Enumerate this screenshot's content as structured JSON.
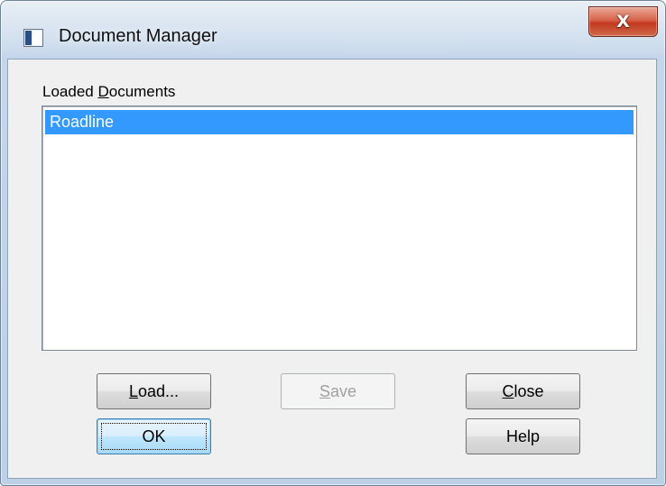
{
  "window": {
    "title": "Document Manager",
    "close_glyph": "X",
    "icon": "app-document-icon"
  },
  "list": {
    "label_prefix": "Loaded ",
    "label_mnemonic": "D",
    "label_rest": "ocuments",
    "items": [
      {
        "label": "Roadline",
        "selected": true
      }
    ]
  },
  "buttons": {
    "load": {
      "mnemonic": "L",
      "rest": "oad..."
    },
    "save": {
      "mnemonic": "S",
      "rest": "ave",
      "enabled": false
    },
    "close": {
      "mnemonic": "C",
      "rest": "lose"
    },
    "ok": {
      "label": "OK"
    },
    "help": {
      "label": "Help"
    }
  },
  "colors": {
    "selection": "#3399ff",
    "close_button": "#c2391f",
    "default_button": "#bee6fd"
  }
}
